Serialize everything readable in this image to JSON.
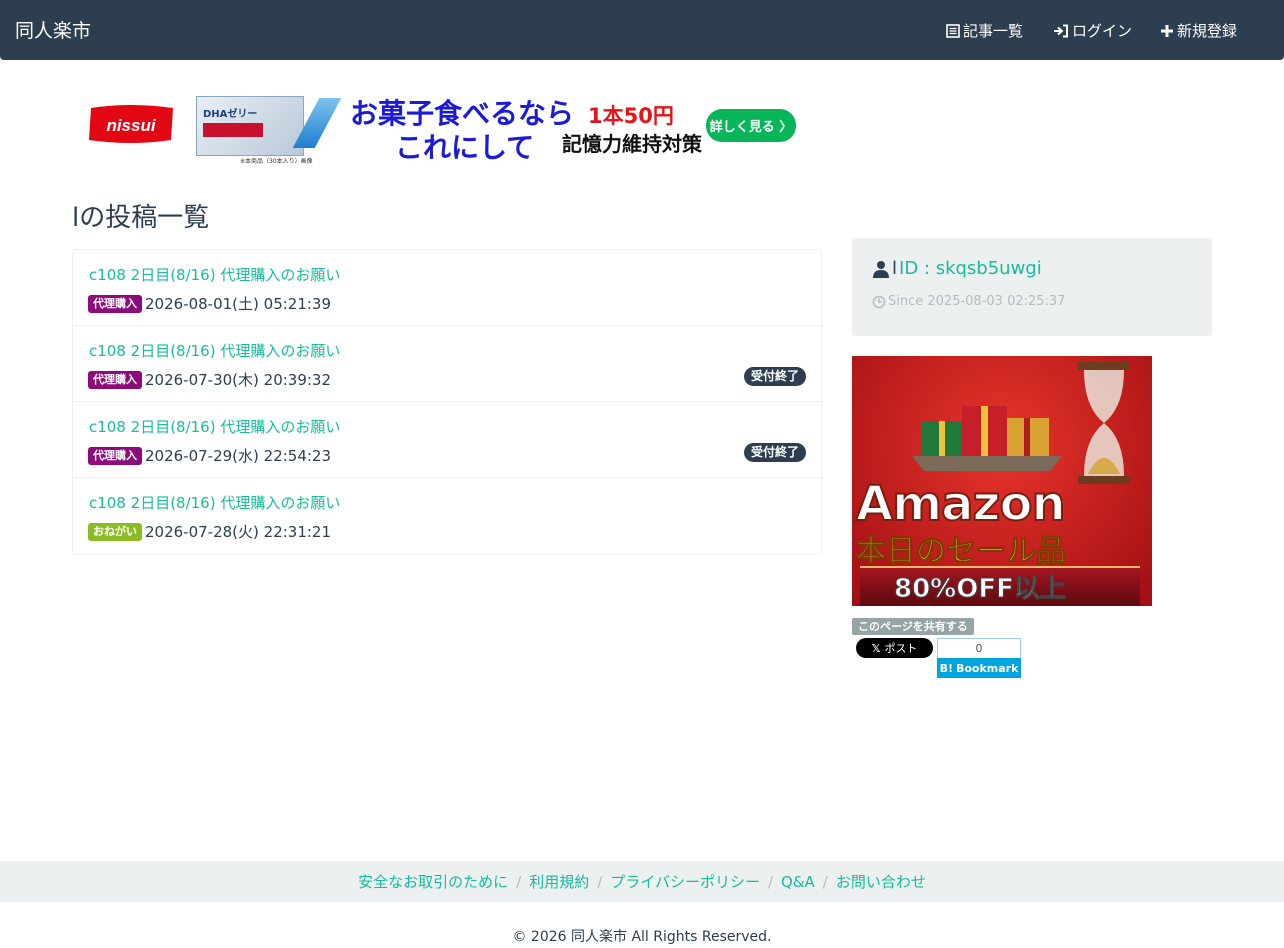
{
  "navbar": {
    "brand": "同人楽市",
    "links": [
      {
        "label": "記事一覧",
        "icon": "list-icon"
      },
      {
        "label": "ログイン",
        "icon": "login-icon"
      },
      {
        "label": "新規登録",
        "icon": "plus-icon"
      }
    ]
  },
  "ad": {
    "logo": "nissui",
    "product_text": "DHAゼリー",
    "note": "※本商品（30本入り）画像",
    "headline1": "お菓子食べるなら",
    "headline2": "これにして",
    "price": "1本50円",
    "subline": "記憶力維持対策",
    "button": "詳しく見る 〉"
  },
  "page": {
    "title": "lの投稿一覧"
  },
  "posts": [
    {
      "title": "c108 2日目(8/16) 代理購入のお願い",
      "category": "代理購入",
      "category_color": "#8e0b7c",
      "date": "2026-08-01(土) 05:21:39",
      "status": ""
    },
    {
      "title": "c108 2日目(8/16) 代理購入のお願い",
      "category": "代理購入",
      "category_color": "#8e0b7c",
      "date": "2026-07-30(木) 20:39:32",
      "status": "受付終了"
    },
    {
      "title": "c108 2日目(8/16) 代理購入のお願い",
      "category": "代理購入",
      "category_color": "#8e0b7c",
      "date": "2026-07-29(水) 22:54:23",
      "status": "受付終了"
    },
    {
      "title": "c108 2日目(8/16) 代理購入のお願い",
      "category": "おねがい",
      "category_color": "#8cbb24",
      "date": "2026-07-28(火) 22:31:21",
      "status": ""
    }
  ],
  "profile": {
    "name": "l",
    "id_text": "ID : skqsb5uwgi",
    "since": "Since 2025-08-03 02:25:37"
  },
  "amazon_ad": {
    "brand": "Amazon",
    "sub": "本日のセール品",
    "off": "80%OFF以上"
  },
  "share": {
    "label": "このページを共有する",
    "x_post": "ポスト",
    "hatena_count": "0",
    "hatena_label": "Bookmark"
  },
  "footer": {
    "links": [
      "安全なお取引のために",
      "利用規約",
      "プライバシーポリシー",
      "Q&A",
      "お問い合わせ"
    ],
    "copyright": "© 2026 同人楽市 All Rights Reserved."
  },
  "colors": {
    "navbar": "#2c3e50",
    "link": "#18bc9c",
    "panel": "#ecf0f1"
  }
}
